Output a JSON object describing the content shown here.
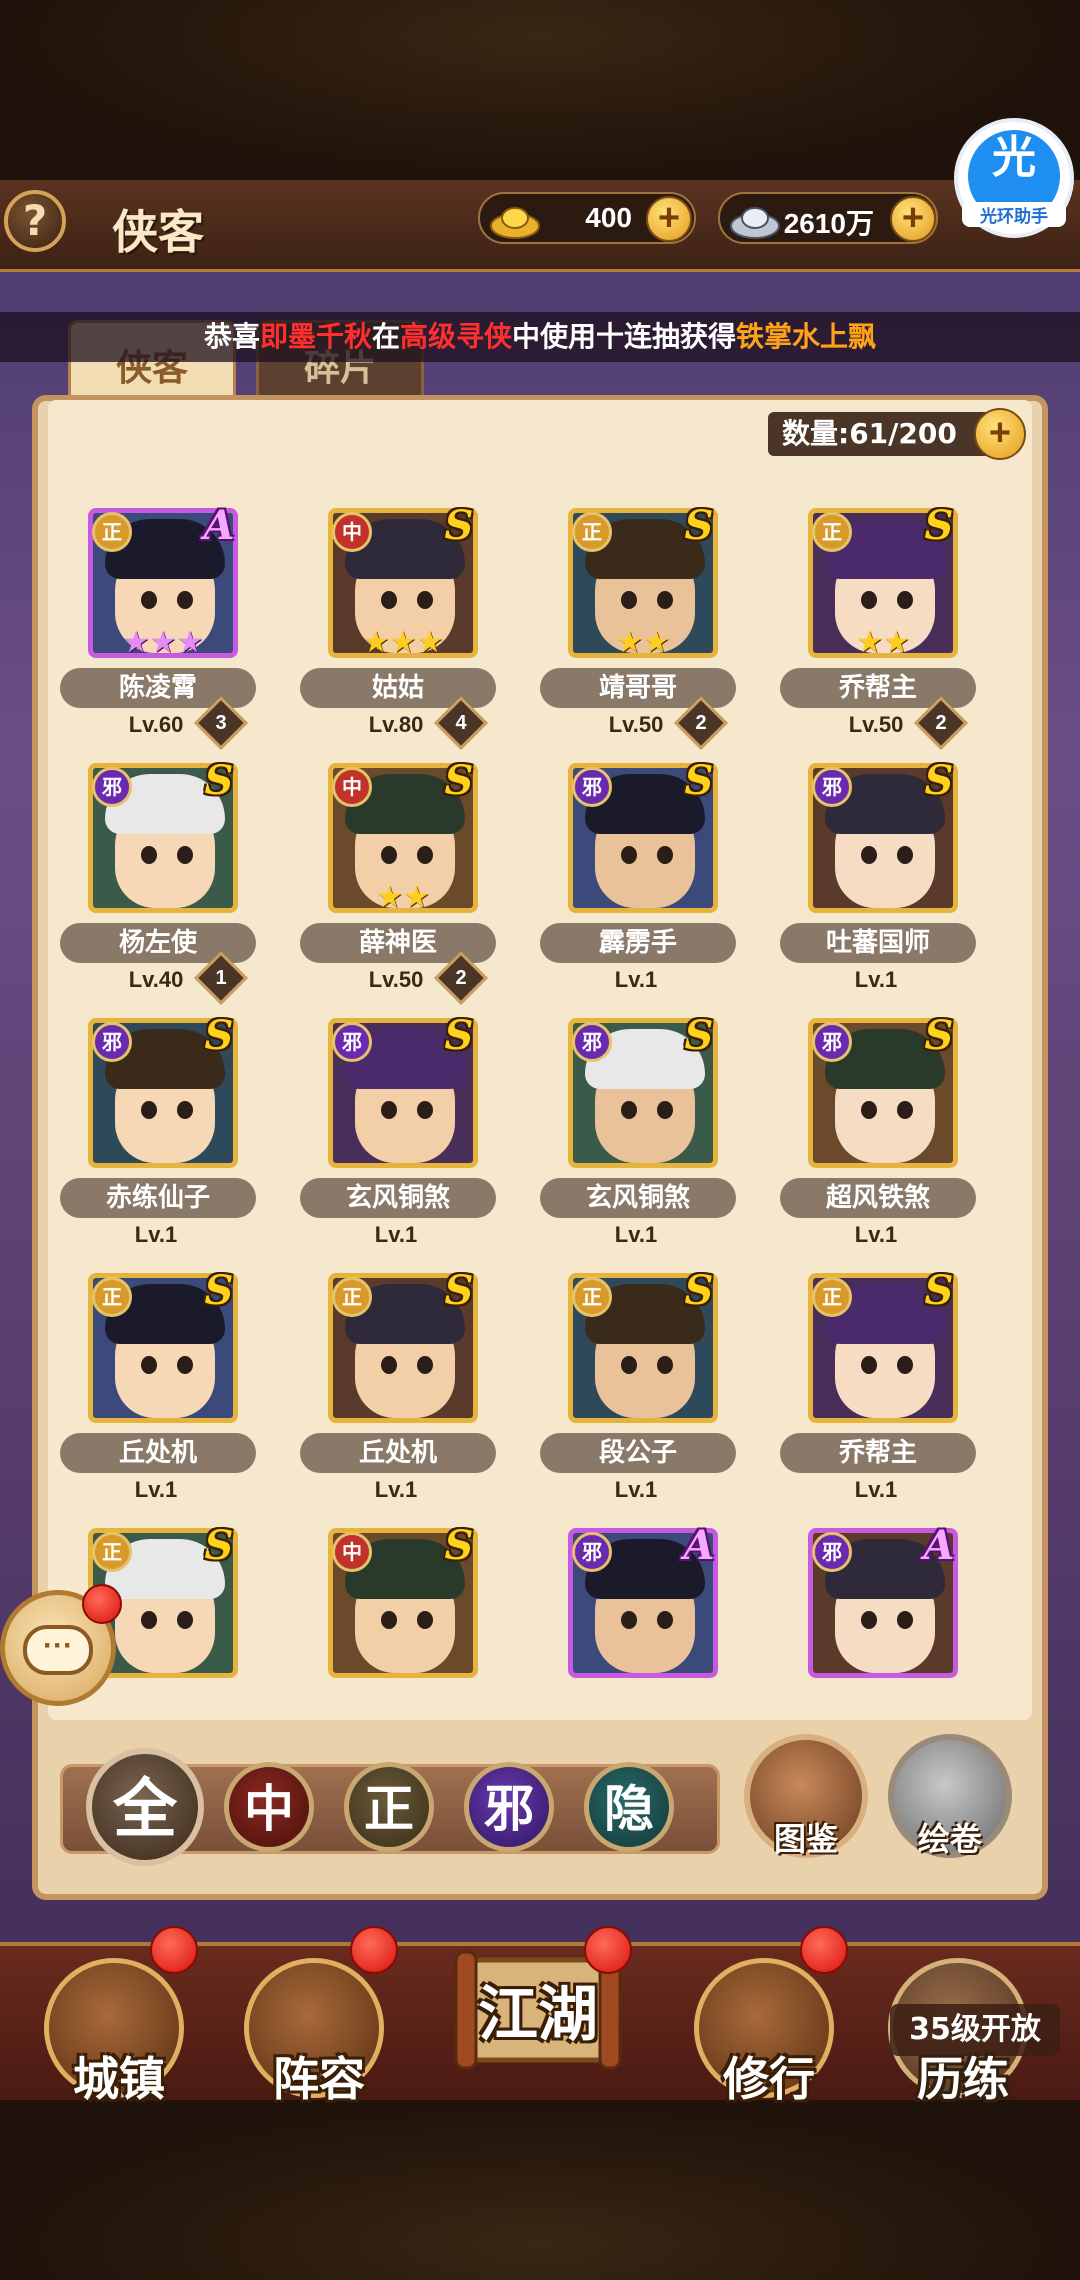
{
  "header": {
    "help_label": "?",
    "title": "侠客",
    "gold": "400",
    "silver": "2610万",
    "helper_glyph": "光",
    "helper_label": "光环助手"
  },
  "ticker": {
    "prefix": "恭喜",
    "player": "即墨千秋",
    "mid1": "在",
    "pool": "高级寻侠",
    "mid2": "中使用十连抽获得",
    "reward": "铁掌水上飘"
  },
  "tabs": [
    "侠客",
    "碎片"
  ],
  "quantity": "数量:61/200",
  "heroes": [
    {
      "faction": "正",
      "grade": "A",
      "stars": "★★★",
      "name": "陈凌霄",
      "level": "Lv.60",
      "rank": "3"
    },
    {
      "faction": "中",
      "grade": "S",
      "stars": "★★★",
      "name": "姑姑",
      "level": "Lv.80",
      "rank": "4"
    },
    {
      "faction": "正",
      "grade": "S",
      "stars": "★★",
      "name": "靖哥哥",
      "level": "Lv.50",
      "rank": "2"
    },
    {
      "faction": "正",
      "grade": "S",
      "stars": "★★",
      "name": "乔帮主",
      "level": "Lv.50",
      "rank": "2"
    },
    {
      "faction": "邪",
      "grade": "S",
      "stars": "",
      "name": "杨左使",
      "level": "Lv.40",
      "rank": "1"
    },
    {
      "faction": "中",
      "grade": "S",
      "stars": "★★",
      "name": "薛神医",
      "level": "Lv.50",
      "rank": "2"
    },
    {
      "faction": "邪",
      "grade": "S",
      "stars": "",
      "name": "霹雳手",
      "level": "Lv.1",
      "rank": ""
    },
    {
      "faction": "邪",
      "grade": "S",
      "stars": "",
      "name": "吐蕃国师",
      "level": "Lv.1",
      "rank": ""
    },
    {
      "faction": "邪",
      "grade": "S",
      "stars": "",
      "name": "赤练仙子",
      "level": "Lv.1",
      "rank": ""
    },
    {
      "faction": "邪",
      "grade": "S",
      "stars": "",
      "name": "玄风铜煞",
      "level": "Lv.1",
      "rank": ""
    },
    {
      "faction": "邪",
      "grade": "S",
      "stars": "",
      "name": "玄风铜煞",
      "level": "Lv.1",
      "rank": ""
    },
    {
      "faction": "邪",
      "grade": "S",
      "stars": "",
      "name": "超风铁煞",
      "level": "Lv.1",
      "rank": ""
    },
    {
      "faction": "正",
      "grade": "S",
      "stars": "",
      "name": "丘处机",
      "level": "Lv.1",
      "rank": ""
    },
    {
      "faction": "正",
      "grade": "S",
      "stars": "",
      "name": "丘处机",
      "level": "Lv.1",
      "rank": ""
    },
    {
      "faction": "正",
      "grade": "S",
      "stars": "",
      "name": "段公子",
      "level": "Lv.1",
      "rank": ""
    },
    {
      "faction": "正",
      "grade": "S",
      "stars": "",
      "name": "乔帮主",
      "level": "Lv.1",
      "rank": ""
    },
    {
      "faction": "正",
      "grade": "S",
      "stars": "",
      "name": "",
      "level": "",
      "rank": ""
    },
    {
      "faction": "中",
      "grade": "S",
      "stars": "",
      "name": "",
      "level": "",
      "rank": ""
    },
    {
      "faction": "邪",
      "grade": "A",
      "stars": "",
      "name": "",
      "level": "",
      "rank": ""
    },
    {
      "faction": "邪",
      "grade": "A",
      "stars": "",
      "name": "",
      "level": "",
      "rank": ""
    }
  ],
  "filters": {
    "all": "全",
    "zhong": "中",
    "zheng": "正",
    "xie": "邪",
    "yin": "隐"
  },
  "side_buttons": {
    "codex": "图鉴",
    "scroll": "绘卷"
  },
  "chat_glyph": "···",
  "nav": {
    "town": "城镇",
    "lineup": "阵容",
    "jianghu": "江湖",
    "train": "修行",
    "trial": "历练",
    "trial_lock": "35级开放"
  },
  "colors": {
    "faction_zheng": "#d89a2a",
    "faction_zhong": "#c0322a",
    "faction_xie": "#6a2ab0",
    "grade_s": "#ffd21c",
    "grade_a": "#f4a8ff",
    "ticker_highlight_red": "#ff2f2f",
    "ticker_highlight_orange": "#ffa21a"
  }
}
